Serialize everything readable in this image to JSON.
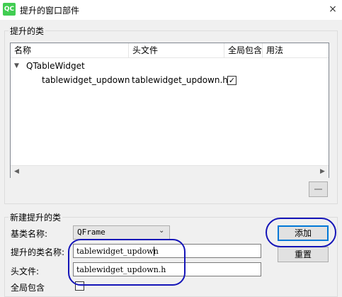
{
  "window": {
    "title": "提升的窗口部件",
    "icon_label": "QC",
    "close_symbol": "×"
  },
  "promoted_group": {
    "title": "提升的类"
  },
  "tree": {
    "columns": [
      "名称",
      "头文件",
      "全局包含",
      "用法"
    ],
    "parent_item": "QTableWidget",
    "child": {
      "name": "tablewidget_updown",
      "header": "tablewidget_updown.h",
      "global_include": true
    },
    "scroll_left": "◀",
    "scroll_right": "▶",
    "expander": "▼",
    "check": "✓"
  },
  "new_group": {
    "title": "新建提升的类",
    "base_class_label": "基类名称:",
    "base_class_value": "QFrame",
    "combo_arrow": "⌄",
    "promoted_name_label": "提升的类名称:",
    "promoted_name_value": "tablewidget_updown",
    "header_label": "头文件:",
    "header_value": "tablewidget_updown.h",
    "global_include_label": "全局包含",
    "global_include": false
  },
  "buttons": {
    "add": "添加",
    "reset": "重置"
  }
}
